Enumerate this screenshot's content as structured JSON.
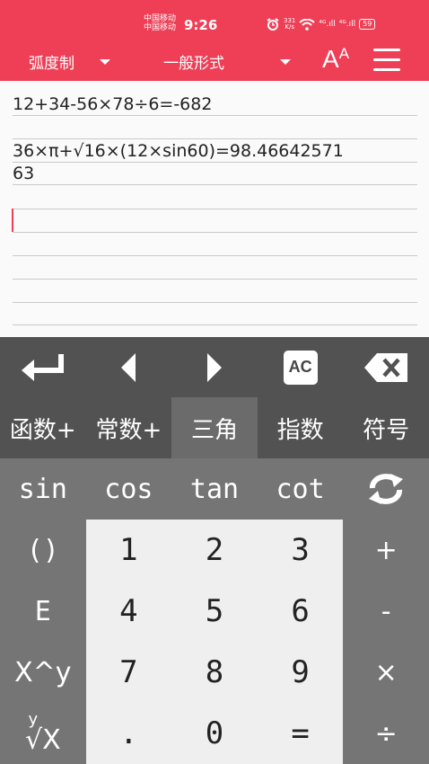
{
  "status_bar": {
    "carrier_1": "中国移动",
    "carrier_2": "中国移动",
    "time": "9:26",
    "net_speed_value": "331",
    "net_speed_unit": "K/s",
    "signal_1": "⁴ᴳ.ıll",
    "signal_2": "⁴ᴳ.ıll",
    "battery": "59"
  },
  "toolbar": {
    "angle_mode": "弧度制",
    "display_format": "一般形式",
    "font_size_big": "A",
    "font_size_small": "A"
  },
  "history": [
    "12+34-56×78÷6=-682",
    "36×π+√16×(12×sin60)=98.46642571",
    "63"
  ],
  "keyboard": {
    "tabs": [
      "函数+",
      "常数+",
      "三角",
      "指数",
      "符号"
    ],
    "active_tab": "三角",
    "ac_label": "AC",
    "trig_row": [
      "sin",
      "cos",
      "tan",
      "cot"
    ],
    "left_col": [
      "()",
      "E",
      "X^y",
      "y",
      "√X"
    ],
    "numbers": [
      "1",
      "2",
      "3",
      "4",
      "5",
      "6",
      "7",
      "8",
      "9",
      ".",
      "0",
      "="
    ],
    "operators": [
      "+",
      "-",
      "×",
      "÷"
    ]
  },
  "colors": {
    "accent": "#ee3f57",
    "keyboard_dark": "#525252",
    "keyboard_mid": "#757575",
    "number_pad": "#efefef"
  }
}
